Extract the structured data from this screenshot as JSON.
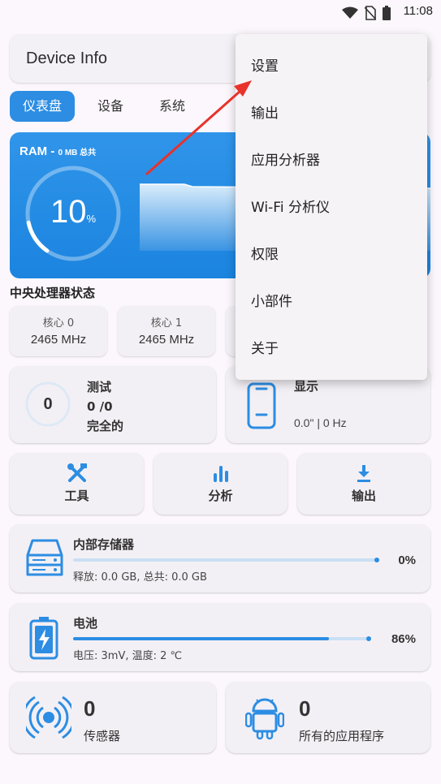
{
  "status_bar": {
    "time": "11:08",
    "icons": [
      "wifi-icon",
      "no-sim-icon",
      "battery-icon"
    ]
  },
  "app_bar": {
    "title": "Device Info"
  },
  "tabs": [
    {
      "label": "仪表盘",
      "active": true
    },
    {
      "label": "设备",
      "active": false
    },
    {
      "label": "系统",
      "active": false
    }
  ],
  "ram": {
    "label": "RAM - ",
    "detail": "0 MB 总共",
    "percent": "10",
    "percent_unit": "%",
    "usage_fraction": 0.1
  },
  "cpu": {
    "title": "中央处理器状态",
    "cores": [
      {
        "label": "核心 0",
        "value": "2465 MHz"
      },
      {
        "label": "核心 1",
        "value": "2465 MHz"
      }
    ]
  },
  "test": {
    "count": "0",
    "title": "测试",
    "progress": "0 /0",
    "status": "完全的"
  },
  "display": {
    "title": "显示",
    "value": "0.0\" | 0 Hz"
  },
  "actions": [
    {
      "label": "工具",
      "icon": "tools-icon"
    },
    {
      "label": "分析",
      "icon": "bar-chart-icon"
    },
    {
      "label": "输出",
      "icon": "download-icon"
    }
  ],
  "storage": {
    "title": "内部存储器",
    "percent": "0%",
    "fill_fraction": 0.0,
    "detail": "释放: 0.0 GB,  总共: 0.0 GB",
    "icon": "hard-drive-icon"
  },
  "battery": {
    "title": "电池",
    "percent": "86%",
    "fill_fraction": 0.86,
    "detail": "电压: 3mV,  温度: 2 ℃",
    "icon": "battery-charging-icon"
  },
  "sensors": {
    "count": "0",
    "label": "传感器",
    "icon": "sensor-waves-icon"
  },
  "apps": {
    "count": "0",
    "label": "所有的应用程序",
    "icon": "android-icon"
  },
  "menu": {
    "items": [
      "设置",
      "输出",
      "应用分析器",
      "Wi-Fi 分析仪",
      "权限",
      "小部件",
      "关于"
    ]
  },
  "colors": {
    "accent": "#2c8de3",
    "card": "#f3f0f5",
    "background": "#fbf7fc",
    "annotation_arrow": "#e8322b"
  }
}
